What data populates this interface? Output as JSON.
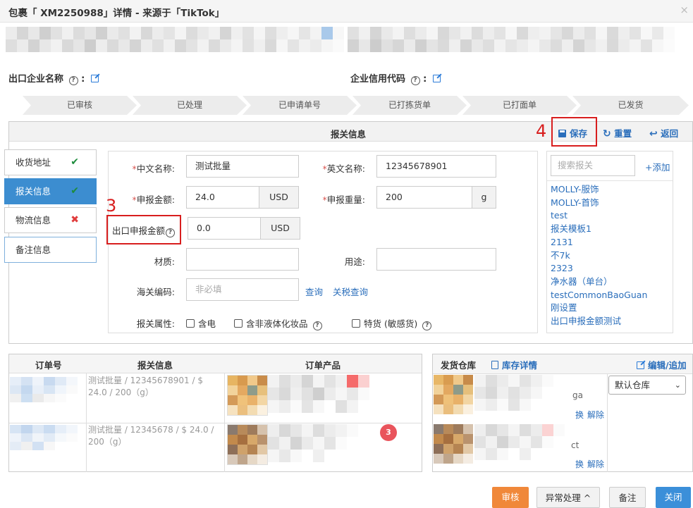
{
  "window": {
    "title": "包裹「 XM2250988」详情 - 来源于「TikTok」",
    "close": "×"
  },
  "company": {
    "export_name_label": "出口企业名称",
    "credit_code_label": "企业信用代码"
  },
  "steps": [
    "已审核",
    "已处理",
    "已申请单号",
    "已打拣货单",
    "已打面单",
    "已发货"
  ],
  "declaration": {
    "title": "报关信息",
    "buttons": {
      "save": "保存",
      "reset": "重置",
      "back": "返回"
    },
    "side_tabs": [
      {
        "label": "收货地址",
        "mark": "✔",
        "mark_color": "#1d8c3c"
      },
      {
        "label": "报关信息",
        "mark": "✔",
        "mark_color": "#1d8c3c"
      },
      {
        "label": "物流信息",
        "mark": "✖",
        "mark_color": "#e03c3c"
      },
      {
        "label": "备注信息",
        "mark": ""
      }
    ],
    "form": {
      "cn_name_label": "中文名称:",
      "cn_name_value": "测试批量",
      "en_name_label": "英文名称:",
      "en_name_value": "12345678901",
      "amount_label": "申报金额:",
      "amount_value": "24.0",
      "amount_unit": "USD",
      "weight_label": "申报重量:",
      "weight_value": "200",
      "weight_unit": "g",
      "export_amount_label": "出口申报金额",
      "export_amount_value": "0.0",
      "export_amount_unit": "USD",
      "material_label": "材质:",
      "material_value": "",
      "usage_label": "用途:",
      "usage_value": "",
      "hs_label": "海关编码:",
      "hs_placeholder": "非必填",
      "query_link": "查询",
      "tariff_link": "关税查询",
      "attr_label": "报关属性:",
      "attrs": [
        "含电",
        "含非液体化妆品",
        "特货 (敏感货)"
      ]
    },
    "templates": {
      "search_placeholder": "搜索报关",
      "add_label": "+添加",
      "items": [
        "MOLLY-服饰",
        "MOLLY-首饰",
        "test",
        "报关模板1",
        "2131",
        "不7k",
        "2323",
        "净水器（单台）",
        "testCommonBaoGuan",
        "刚设置",
        "出口申报金额测试"
      ]
    }
  },
  "order_table": {
    "headers": [
      "订单号",
      "报关信息",
      "订单产品"
    ],
    "rows": [
      {
        "decl": "测试批量 / 12345678901 / $ 24.0 / 200（g）"
      },
      {
        "decl": "测试批量 / 12345678 / $ 24.0 / 200（g）"
      }
    ],
    "badge": "3"
  },
  "warehouse_table": {
    "header": "发货仓库",
    "stock_link": "库存详情",
    "edit_link": "编辑/追加",
    "select_value": "默认仓库",
    "partial_text": [
      "ga",
      "换",
      "解除",
      "ct",
      "换",
      "解除"
    ]
  },
  "footer_buttons": {
    "audit": "审核",
    "exception": "异常处理",
    "note": "备注",
    "close": "关闭"
  },
  "annotations": {
    "step3": "3",
    "step4": "4"
  },
  "colors": {
    "accent": "#3c8dd0",
    "audit": "#f0883a",
    "close_btn": "#3b8fd9",
    "annotation": "#d81e1e"
  }
}
